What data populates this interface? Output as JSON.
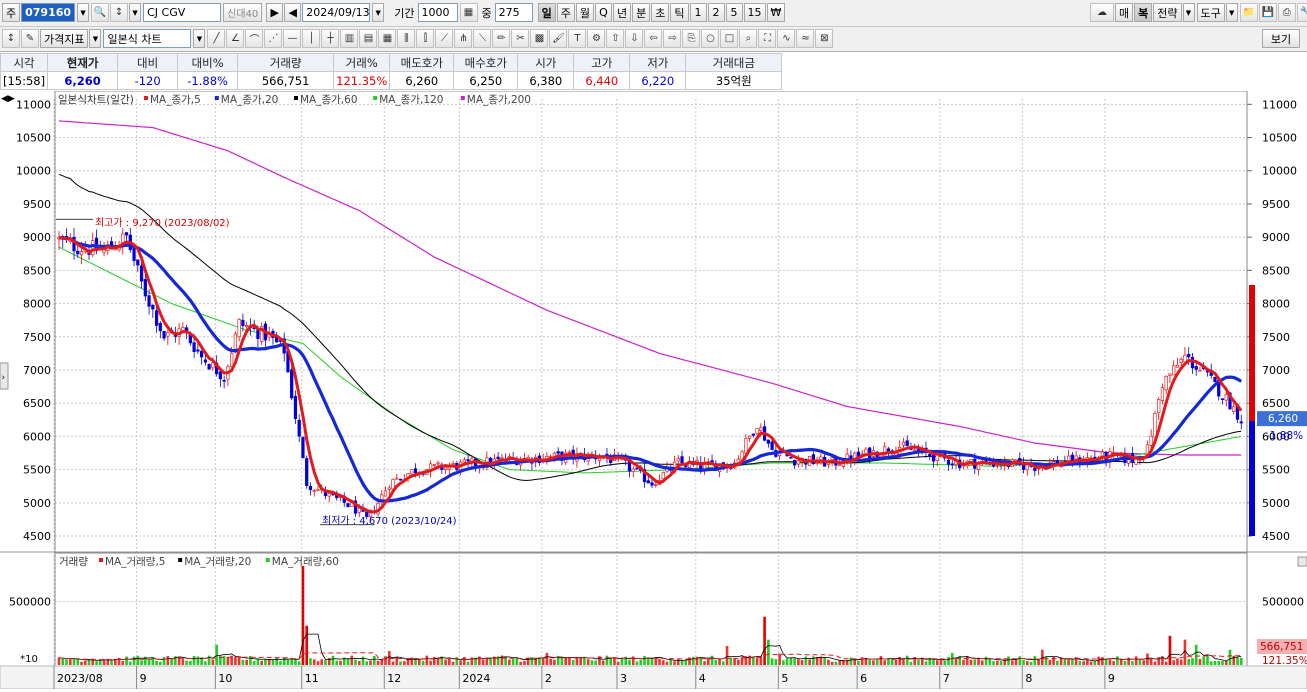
{
  "toolbar": {
    "label_ju": "주",
    "stock_code": "079160",
    "stock_name": "CJ CGV",
    "stock_badges": "신대40",
    "date": "2024/09/13",
    "period_label": "기간",
    "period_value": "1000",
    "jung_label": "중",
    "jung_value": "275",
    "timeframes": [
      "일",
      "주",
      "월",
      "Q",
      "년",
      "분",
      "초",
      "틱",
      "1",
      "2",
      "5",
      "15",
      "₩"
    ],
    "right_buttons": [
      "매",
      "복",
      "전략",
      "도구"
    ],
    "price_indicator": "가격지표",
    "chart_type": "일본식 차트",
    "view_button": "보기"
  },
  "quote_table": {
    "headers": [
      "시각",
      "현재가",
      "대비",
      "대비%",
      "거래량",
      "거래%",
      "매도호가",
      "매수호가",
      "시가",
      "고가",
      "저가",
      "거래대금"
    ],
    "values": [
      "[15:58]",
      "6,260",
      "-120",
      "-1.88%",
      "566,751",
      "121.35%",
      "6,260",
      "6,250",
      "6,380",
      "6,440",
      "6,220",
      "35억원"
    ]
  },
  "colors": {
    "up": "#e60000",
    "down": "#0000dd",
    "ma5": "#e31a1c",
    "ma20": "#1428d8",
    "ma60": "#000000",
    "ma120": "#22cc22",
    "ma200": "#cc22cc"
  },
  "chart_data": [
    {
      "type": "candlestick",
      "title": "일본식차트(일간)",
      "legend": [
        "MA_종가,5",
        "MA_종가,20",
        "MA_종가,60",
        "MA_종가,120",
        "MA_종가,200"
      ],
      "y_ticks": [
        4500,
        5000,
        5500,
        6000,
        6500,
        7000,
        7500,
        8000,
        8500,
        9000,
        9500,
        10000,
        10500,
        11000
      ],
      "ylim": [
        4350,
        11080
      ],
      "x_labels": [
        "2023/08",
        "9",
        "10",
        "11",
        "12",
        "2024",
        "2",
        "3",
        "4",
        "5",
        "6",
        "7",
        "8",
        "9"
      ],
      "annotations": {
        "high": "최고가 : 9,270 (2023/08/02)",
        "low": "최저가 : 4,670 (2023/10/24)"
      },
      "last_price": "6,260",
      "last_change": "-1.88%",
      "close_anchors": [
        [
          0,
          8950
        ],
        [
          5,
          8850
        ],
        [
          12,
          8800
        ],
        [
          18,
          9000
        ],
        [
          22,
          8300
        ],
        [
          28,
          7500
        ],
        [
          33,
          7600
        ],
        [
          38,
          7200
        ],
        [
          44,
          6900
        ],
        [
          48,
          7700
        ],
        [
          52,
          7600
        ],
        [
          56,
          7500
        ],
        [
          60,
          7300
        ],
        [
          66,
          5300
        ],
        [
          72,
          5100
        ],
        [
          78,
          4950
        ],
        [
          82,
          4750
        ],
        [
          85,
          5000
        ],
        [
          88,
          5300
        ],
        [
          95,
          5500
        ],
        [
          105,
          5550
        ],
        [
          120,
          5650
        ],
        [
          135,
          5700
        ],
        [
          145,
          5700
        ],
        [
          150,
          5600
        ],
        [
          158,
          5300
        ],
        [
          165,
          5600
        ],
        [
          172,
          5550
        ],
        [
          180,
          5600
        ],
        [
          186,
          6200
        ],
        [
          190,
          5800
        ],
        [
          196,
          5650
        ],
        [
          206,
          5600
        ],
        [
          216,
          5750
        ],
        [
          224,
          5850
        ],
        [
          230,
          5750
        ],
        [
          240,
          5600
        ],
        [
          250,
          5600
        ],
        [
          260,
          5550
        ],
        [
          272,
          5650
        ],
        [
          280,
          5700
        ],
        [
          286,
          5650
        ],
        [
          290,
          5800
        ],
        [
          294,
          6800
        ],
        [
          300,
          7200
        ],
        [
          306,
          6900
        ],
        [
          312,
          6500
        ],
        [
          315,
          6260
        ]
      ],
      "ma200_anchors": [
        [
          0,
          10750
        ],
        [
          25,
          10650
        ],
        [
          45,
          10300
        ],
        [
          60,
          9900
        ],
        [
          80,
          9400
        ],
        [
          100,
          8700
        ],
        [
          130,
          7900
        ],
        [
          160,
          7250
        ],
        [
          190,
          6800
        ],
        [
          210,
          6450
        ],
        [
          240,
          6150
        ],
        [
          260,
          5900
        ],
        [
          280,
          5750
        ],
        [
          300,
          5720
        ],
        [
          315,
          5720
        ]
      ],
      "ma120_anchors": [
        [
          0,
          8850
        ],
        [
          30,
          8000
        ],
        [
          50,
          7600
        ],
        [
          65,
          7400
        ],
        [
          75,
          6900
        ],
        [
          90,
          6300
        ],
        [
          105,
          5800
        ],
        [
          120,
          5500
        ],
        [
          140,
          5450
        ],
        [
          165,
          5500
        ],
        [
          190,
          5600
        ],
        [
          220,
          5600
        ],
        [
          250,
          5550
        ],
        [
          280,
          5650
        ],
        [
          300,
          5850
        ],
        [
          315,
          6000
        ]
      ]
    },
    {
      "type": "bar",
      "title": "거래량",
      "legend": [
        "MA_거래량,5",
        "MA_거래량,20",
        "MA_거래량,60"
      ],
      "y_ticks": [
        500000
      ],
      "y_tick_labels": [
        "500000"
      ],
      "scale_label": "*10",
      "last_volume": "566,751",
      "last_volume_pct": "121.35%",
      "base_volume": 55000,
      "spikes": [
        [
          42,
          160000
        ],
        [
          65,
          780000
        ],
        [
          66,
          310000
        ],
        [
          88,
          110000
        ],
        [
          118,
          75000
        ],
        [
          130,
          95000
        ],
        [
          158,
          60000
        ],
        [
          178,
          150000
        ],
        [
          188,
          380000
        ],
        [
          189,
          200000
        ],
        [
          192,
          90000
        ],
        [
          238,
          95000
        ],
        [
          262,
          120000
        ],
        [
          290,
          90000
        ],
        [
          296,
          230000
        ],
        [
          300,
          200000
        ],
        [
          303,
          160000
        ],
        [
          312,
          120000
        ],
        [
          315,
          57000
        ]
      ],
      "ylim": [
        0,
        820000
      ]
    }
  ]
}
